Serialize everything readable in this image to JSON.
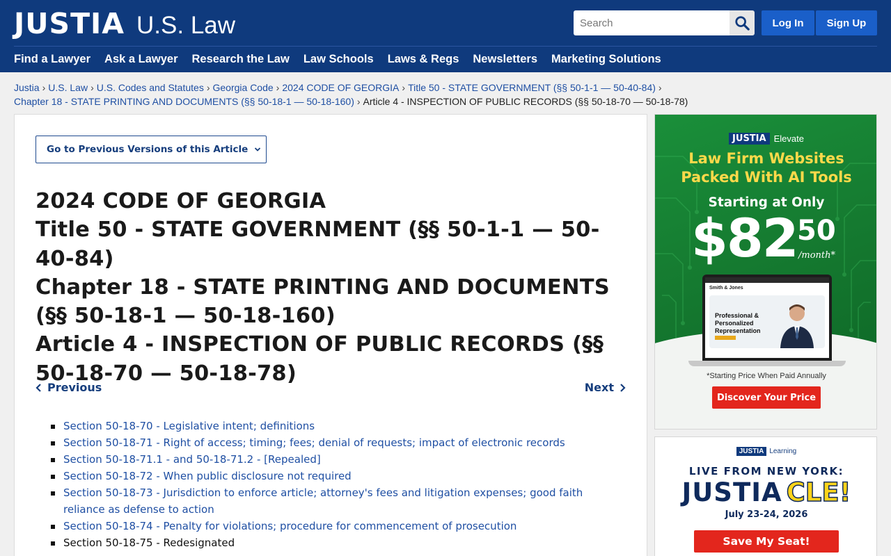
{
  "header": {
    "logo_main": "JUSTIA",
    "logo_sub": "U.S. Law",
    "search_placeholder": "Search",
    "login_label": "Log In",
    "signup_label": "Sign Up",
    "brand_color": "#0f3a7d",
    "nav": [
      "Find a Lawyer",
      "Ask a Lawyer",
      "Research the Law",
      "Law Schools",
      "Laws & Regs",
      "Newsletters",
      "Marketing Solutions"
    ]
  },
  "breadcrumb": {
    "links": [
      "Justia",
      "U.S. Law",
      "U.S. Codes and Statutes",
      "Georgia Code",
      "2024 CODE OF GEORGIA",
      "Title 50 - STATE GOVERNMENT (§§ 50-1-1 — 50-40-84)",
      "Chapter 18 - STATE PRINTING AND DOCUMENTS (§§ 50-18-1 — 50-18-160)"
    ],
    "current": "Article 4 - INSPECTION OF PUBLIC RECORDS (§§ 50-18-70 — 50-18-78)"
  },
  "main": {
    "versions_button": "Go to Previous Versions of this Article",
    "titles": [
      "2024 CODE OF GEORGIA",
      "Title 50 - STATE GOVERNMENT (§§ 50-1-1 — 50-40-84)",
      "Chapter 18 - STATE PRINTING AND DOCUMENTS (§§ 50-18-1 — 50-18-160)",
      "Article 4 - INSPECTION OF PUBLIC RECORDS (§§ 50-18-70 — 50-18-78)"
    ],
    "previous_label": "Previous",
    "next_label": "Next",
    "sections": [
      "Section 50-18-70 - Legislative intent; definitions",
      "Section 50-18-71 - Right of access; timing; fees; denial of requests; impact of electronic records",
      "Section 50-18-71.1 - and 50-18-71.2 - [Repealed]",
      "Section 50-18-72 - When public disclosure not required",
      "Section 50-18-73 - Jurisdiction to enforce article; attorney's fees and litigation expenses; good faith reliance as defense to action",
      "Section 50-18-74 - Penalty for violations; procedure for commencement of prosecution",
      "Section 50-18-75 - Redesignated"
    ]
  },
  "ad1": {
    "brand_tag": "JUSTIA",
    "brand_name": "Elevate",
    "headline_1": "Law Firm Websites",
    "headline_2": "Packed With AI Tools",
    "starting": "Starting at Only",
    "price": "$82",
    "cents": "50",
    "per": "/month*",
    "screen_brand": "Smith & Jones",
    "screen_text_1": "Professional &",
    "screen_text_2": "Personalized",
    "screen_text_3": "Representation",
    "footnote": "*Starting Price When Paid Annually",
    "cta": "Discover Your Price"
  },
  "ad2": {
    "brand_tag": "JUSTIA",
    "brand_name": "Learning",
    "live": "LIVE FROM NEW YORK:",
    "title_main": "JUSTIA",
    "title_accent": "CLE!",
    "date": "July 23-24, 2026",
    "cta": "Save My Seat!"
  }
}
